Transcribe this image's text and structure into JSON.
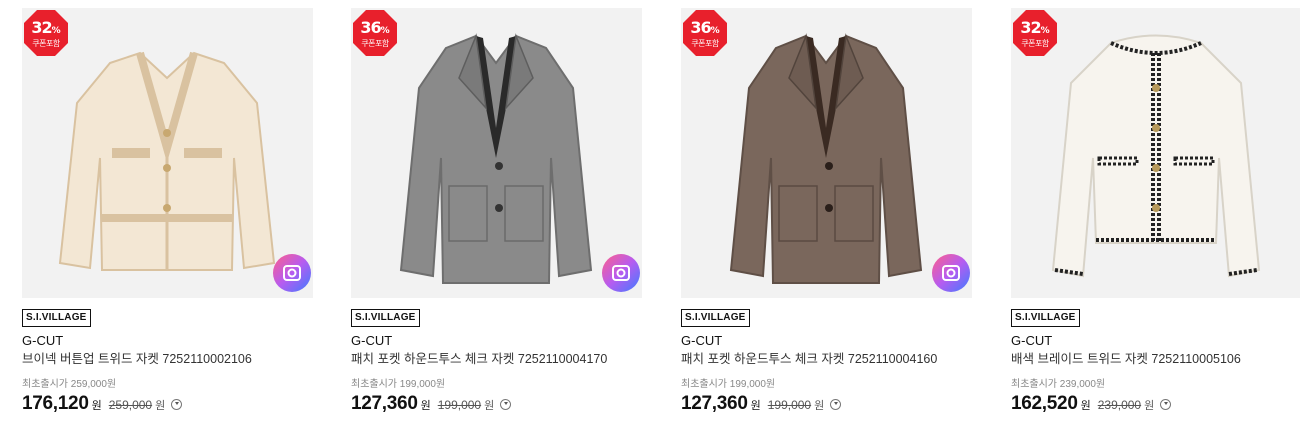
{
  "products": [
    {
      "discount": "32",
      "discount_unit": "%",
      "coupon_label": "쿠폰포함",
      "brand_tag": "S.I.VILLAGE",
      "brand": "G-CUT",
      "title": "브이넥 버튼업 트위드 자켓 7252110002106",
      "first_price_label": "최초출시가 259,000원",
      "price": "176,120",
      "price_unit": "원",
      "original_price": "259,000",
      "original_unit": "원",
      "has_camera": true,
      "colors": {
        "bg": "#f2f2f2",
        "body": "#f3e7d4",
        "trim": "#d9c2a0"
      }
    },
    {
      "discount": "36",
      "discount_unit": "%",
      "coupon_label": "쿠폰포함",
      "brand_tag": "S.I.VILLAGE",
      "brand": "G-CUT",
      "title": "패치 포켓 하운드투스 체크 자켓 7252110004170",
      "first_price_label": "최초출시가 199,000원",
      "price": "127,360",
      "price_unit": "원",
      "original_price": "199,000",
      "original_unit": "원",
      "has_camera": true,
      "colors": {
        "bg": "#f2f2f2",
        "body": "#8a8a8a",
        "trim": "#6e6e6e"
      }
    },
    {
      "discount": "36",
      "discount_unit": "%",
      "coupon_label": "쿠폰포함",
      "brand_tag": "S.I.VILLAGE",
      "brand": "G-CUT",
      "title": "패치 포켓 하운드투스 체크 자켓 7252110004160",
      "first_price_label": "최초출시가 199,000원",
      "price": "127,360",
      "price_unit": "원",
      "original_price": "199,000",
      "original_unit": "원",
      "has_camera": true,
      "colors": {
        "bg": "#f2f2f2",
        "body": "#7a675c",
        "trim": "#5f4f46"
      }
    },
    {
      "discount": "32",
      "discount_unit": "%",
      "coupon_label": "쿠폰포함",
      "brand_tag": "S.I.VILLAGE",
      "brand": "G-CUT",
      "title": "배색 브레이드 트위드 자켓 7252110005106",
      "first_price_label": "최초출시가 239,000원",
      "price": "162,520",
      "price_unit": "원",
      "original_price": "239,000",
      "original_unit": "원",
      "has_camera": false,
      "colors": {
        "bg": "#f2f2f2",
        "body": "#f7f4ee",
        "trim": "#222222"
      }
    }
  ],
  "theme": {
    "badge_red": "#e8202c"
  }
}
